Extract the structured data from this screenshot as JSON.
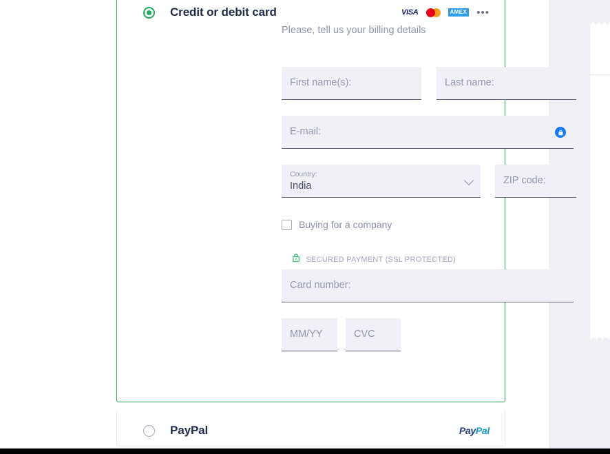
{
  "colors": {
    "accent_green": "#21a95a",
    "title_navy": "#1f2a4a",
    "muted_text": "#9096ad",
    "field_bg": "#f1f0f6",
    "field_underline": "#5b6277",
    "lock_blue": "#1878f0",
    "visa_navy": "#1a1f71",
    "mastercard_red": "#eb001b",
    "mastercard_orange": "#f79e1b",
    "amex_blue": "#2e9ce6",
    "paypal_dark": "#253b80",
    "paypal_light": "#179bd7",
    "sidebar_bg": "#f0eff5"
  },
  "payment_methods": [
    {
      "id": "credit-or-debit-card",
      "title": "Credit or debit card",
      "selected": true,
      "subtitle": "Please, tell us your billing details",
      "brands": [
        {
          "name": "visa-logo",
          "label": "VISA"
        },
        {
          "name": "mastercard-logo",
          "label": ""
        },
        {
          "name": "amex-logo",
          "label": "AMEX"
        },
        {
          "name": "more-card-brands-icon",
          "label": "•••"
        }
      ]
    },
    {
      "id": "paypal",
      "title": "PayPal",
      "selected": false,
      "brand": {
        "name": "paypal-logo",
        "part1": "Pay",
        "part2": "Pal"
      }
    }
  ],
  "form": {
    "first_name": {
      "label": "First name(s):",
      "value": ""
    },
    "last_name": {
      "label": "Last name:",
      "value": ""
    },
    "email": {
      "label": "E-mail:",
      "value": "",
      "badge_icon": "lock-icon"
    },
    "country": {
      "label": "Country:",
      "value": "India",
      "chevron": "chevron-down-icon"
    },
    "zip": {
      "label": "ZIP code:",
      "value": ""
    },
    "buying_for_company": {
      "label": "Buying for a company",
      "checked": false
    },
    "card_number": {
      "label": "Card number:",
      "value": ""
    },
    "expiry": {
      "label": "MM/YY",
      "value": ""
    },
    "cvc": {
      "label": "CVC",
      "value": ""
    }
  },
  "security": {
    "icon": "green-lock-icon",
    "label": "SECURED PAYMENT (SSL PROTECTED)"
  }
}
